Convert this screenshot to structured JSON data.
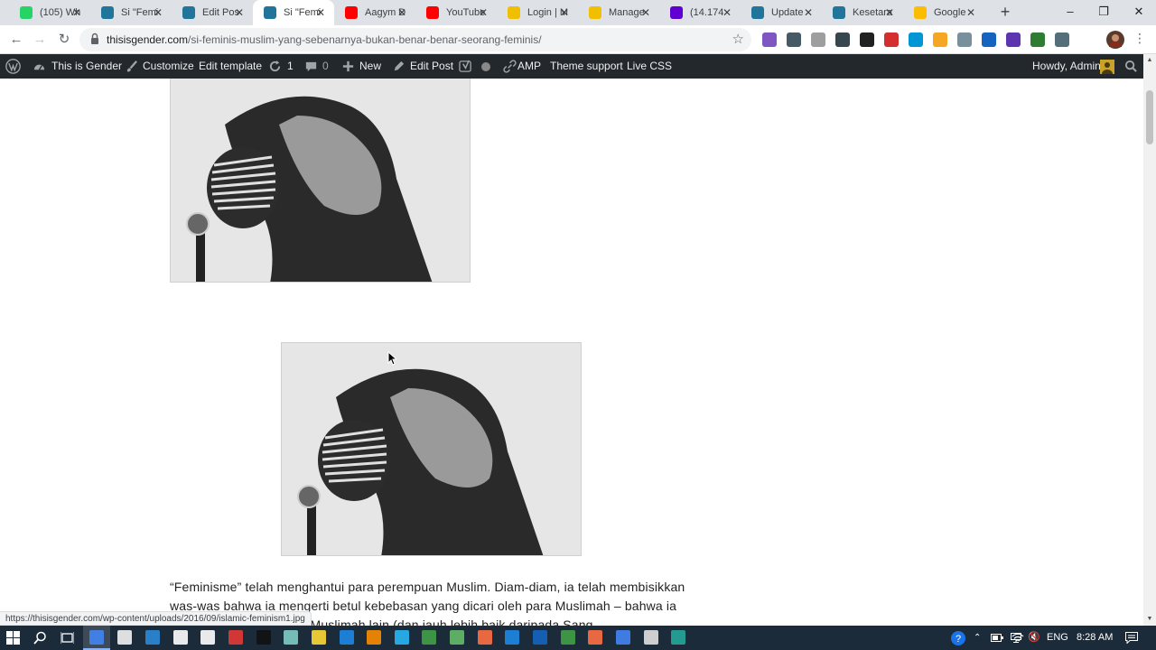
{
  "browser": {
    "tabs": [
      {
        "title": "(105) Wh",
        "favicon": "whatsapp-icon",
        "color": "#25d366",
        "active": false
      },
      {
        "title": "Si \"Femi",
        "favicon": "wordpress-icon",
        "color": "#21759b",
        "active": false
      },
      {
        "title": "Edit Pos",
        "favicon": "wordpress-icon",
        "color": "#21759b",
        "active": false
      },
      {
        "title": "Si \"Femi",
        "favicon": "wordpress-icon",
        "color": "#21759b",
        "active": true
      },
      {
        "title": "Aagym D",
        "favicon": "youtube-icon",
        "color": "#ff0000",
        "active": false
      },
      {
        "title": "YouTube",
        "favicon": "youtube-icon",
        "color": "#ff0000",
        "active": false
      },
      {
        "title": "Login | M",
        "favicon": "cpanel-icon",
        "color": "#f0c000",
        "active": false
      },
      {
        "title": "Manage",
        "favicon": "cpanel-icon",
        "color": "#f0c000",
        "active": false
      },
      {
        "title": "(14.174",
        "favicon": "yahoo-mail-icon",
        "color": "#6001d2",
        "active": false
      },
      {
        "title": "Update",
        "favicon": "wordpress-icon",
        "color": "#21759b",
        "active": false
      },
      {
        "title": "Kesetara",
        "favicon": "wordpress-icon",
        "color": "#21759b",
        "active": false
      },
      {
        "title": "Google",
        "favicon": "google-keep-icon",
        "color": "#fbbc04",
        "active": false
      }
    ],
    "url_domain": "thisisgender.com",
    "url_path": "/si-feminis-muslim-yang-sebenarnya-bukan-benar-benar-seorang-feminis/"
  },
  "adminbar": {
    "site_name": "This is Gender",
    "customize": "Customize",
    "edit_template": "Edit template",
    "updates_count": "1",
    "comments_count": "0",
    "new": "New",
    "edit_post": "Edit Post",
    "amp": "AMP",
    "theme_support": "Theme support",
    "live_css": "Live CSS",
    "howdy": "Howdy, Admin"
  },
  "article": {
    "paragraph": "“Feminisme” telah menghantui para perempuan Muslim. Diam-diam, ia telah membisikkan was-was bahwa ia mengerti betul kebebasan yang dicari oleh para Muslimah – bahwa ia jauh lebih baik daripada Muslimah lain (dan jauh lebih baik daripada Sang"
  },
  "status_bar_url": "https://thisisgender.com/wp-content/uploads/2016/09/islamic-feminism1.jpg",
  "taskbar": {
    "language": "ENG",
    "time": "8:28 AM"
  }
}
